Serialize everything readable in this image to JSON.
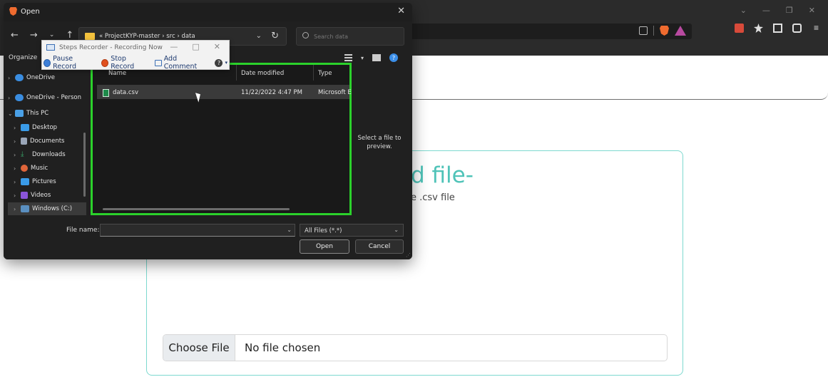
{
  "browser": {
    "window_controls": [
      "⌄",
      "—",
      "❐",
      "✕"
    ]
  },
  "upload": {
    "title": "d file-",
    "subtitle": "e .csv file",
    "choose_label": "Choose File",
    "no_file_text": "No file chosen",
    "accent_color": "#4fc3b8",
    "border_color": "#7dd9cf"
  },
  "dialog": {
    "title": "Open",
    "close": "✕",
    "path": [
      "ProjectKYP-master",
      "src",
      "data"
    ],
    "path_text": "« ProjectKYP-master  ›  src  ›  data",
    "search_placeholder": "Search data",
    "organize": "Organize",
    "nav_items": [
      {
        "label": "OneDrive",
        "icon": "cloud-icon",
        "color": "#3a8de0"
      },
      {
        "label": "OneDrive - Person",
        "icon": "cloud-icon",
        "color": "#3a8de0"
      },
      {
        "label": "This PC",
        "icon": "pc-icon",
        "color": "#4aa0e6"
      },
      {
        "label": "Desktop",
        "icon": "desktop-icon",
        "color": "#3a9be8"
      },
      {
        "label": "Documents",
        "icon": "documents-icon",
        "color": "#9aa6b8"
      },
      {
        "label": "Downloads",
        "icon": "download-icon",
        "color": "#3aa86b"
      },
      {
        "label": "Music",
        "icon": "music-icon",
        "color": "#e0653a"
      },
      {
        "label": "Pictures",
        "icon": "pictures-icon",
        "color": "#3a9be8"
      },
      {
        "label": "Videos",
        "icon": "videos-icon",
        "color": "#8a55d8"
      },
      {
        "label": "Windows (C:)",
        "icon": "drive-icon",
        "color": "#5a8fc0"
      }
    ],
    "columns": [
      "Name",
      "Date modified",
      "Type"
    ],
    "files": [
      {
        "name": "data.csv",
        "date": "11/22/2022 4:47 PM",
        "type": "Microsoft E"
      }
    ],
    "preview_text": "Select a file to preview.",
    "file_name_label": "File name:",
    "file_type": "All Files (*.*)",
    "open_label": "Open",
    "cancel_label": "Cancel",
    "highlight_color": "#2bd12b"
  },
  "steps_recorder": {
    "title": "Steps Recorder - Recording Now",
    "pause": "Pause Record",
    "stop": "Stop Record",
    "comment": "Add Comment"
  }
}
